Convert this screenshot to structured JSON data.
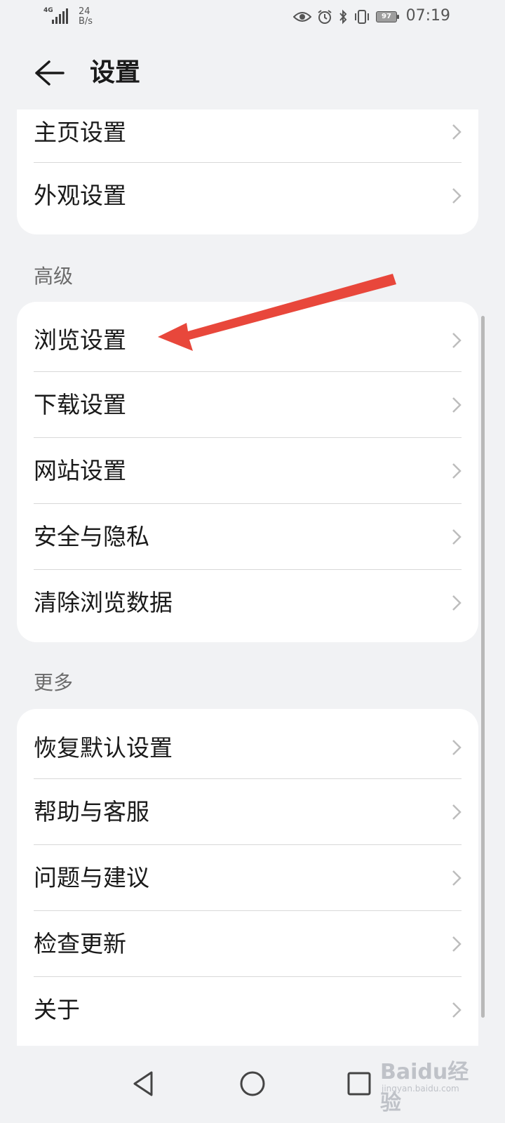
{
  "status_bar": {
    "network": "4G",
    "speed_value": "24",
    "speed_unit": "B/s",
    "battery": "97",
    "time": "07:19"
  },
  "header": {
    "title": "设置"
  },
  "group_top": {
    "items": [
      {
        "label": "主页设置"
      },
      {
        "label": "外观设置"
      }
    ]
  },
  "group_advanced": {
    "title": "高级",
    "items": [
      {
        "label": "浏览设置"
      },
      {
        "label": "下载设置"
      },
      {
        "label": "网站设置"
      },
      {
        "label": "安全与隐私"
      },
      {
        "label": "清除浏览数据"
      }
    ]
  },
  "group_more": {
    "title": "更多",
    "items": [
      {
        "label": "恢复默认设置"
      },
      {
        "label": "帮助与客服"
      },
      {
        "label": "问题与建议"
      },
      {
        "label": "检查更新"
      },
      {
        "label": "关于"
      }
    ]
  },
  "watermark": {
    "text": "Baidu经验",
    "sub": "jingyan.baidu.com"
  },
  "colors": {
    "background": "#f1f2f4",
    "card": "#ffffff",
    "annotation_arrow": "#e8473b"
  }
}
